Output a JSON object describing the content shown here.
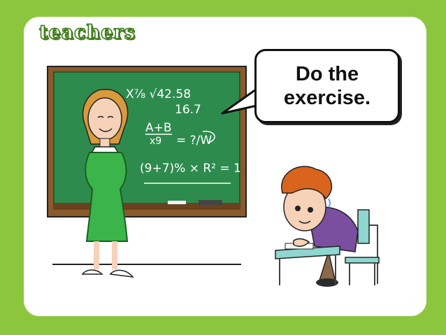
{
  "slide": {
    "title": "teachers",
    "speech_bubble": "Do the exercise.",
    "board_lines": [
      "X⅞ √42.58",
      "16.7",
      "A+B",
      "x9",
      "= ?/W",
      "(9+7)% × R² = 1"
    ]
  },
  "colors": {
    "background": "#8cc63f",
    "card": "#ffffff",
    "chalkboard": "#2e8b4e",
    "board_frame": "#8b5a2b",
    "teacher_dress": "#3bb54a",
    "student_shirt": "#7b4fa0",
    "student_hair": "#d9641e"
  }
}
